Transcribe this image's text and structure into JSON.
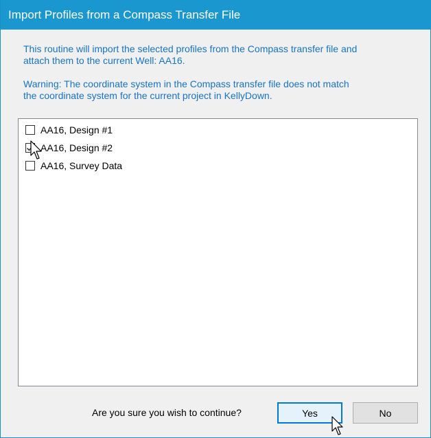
{
  "window": {
    "title": "Import Profiles from a Compass Transfer File"
  },
  "info": {
    "line1": "This routine will import the selected profiles from the Compass transfer file and",
    "line2": "attach them to the current Well: AA16.",
    "warning_line1": "Warning: The coordinate system in the Compass transfer file does not match",
    "warning_line2": "the coordinate system for the current project in KellyDown."
  },
  "profiles": [
    {
      "label": "AA16, Design #1",
      "checked": false
    },
    {
      "label": "AA16, Design #2",
      "checked": true
    },
    {
      "label": "AA16, Survey Data",
      "checked": false
    }
  ],
  "footer": {
    "question": "Are you sure you wish to continue?",
    "yes_label": "Yes",
    "no_label": "No"
  },
  "colors": {
    "titlebar": "#1b97cf",
    "info_text": "#1673c9",
    "default_button_border": "#0078d7"
  },
  "icons": {
    "cursor": "arrow-cursor-icon",
    "check": "checkmark-icon"
  }
}
